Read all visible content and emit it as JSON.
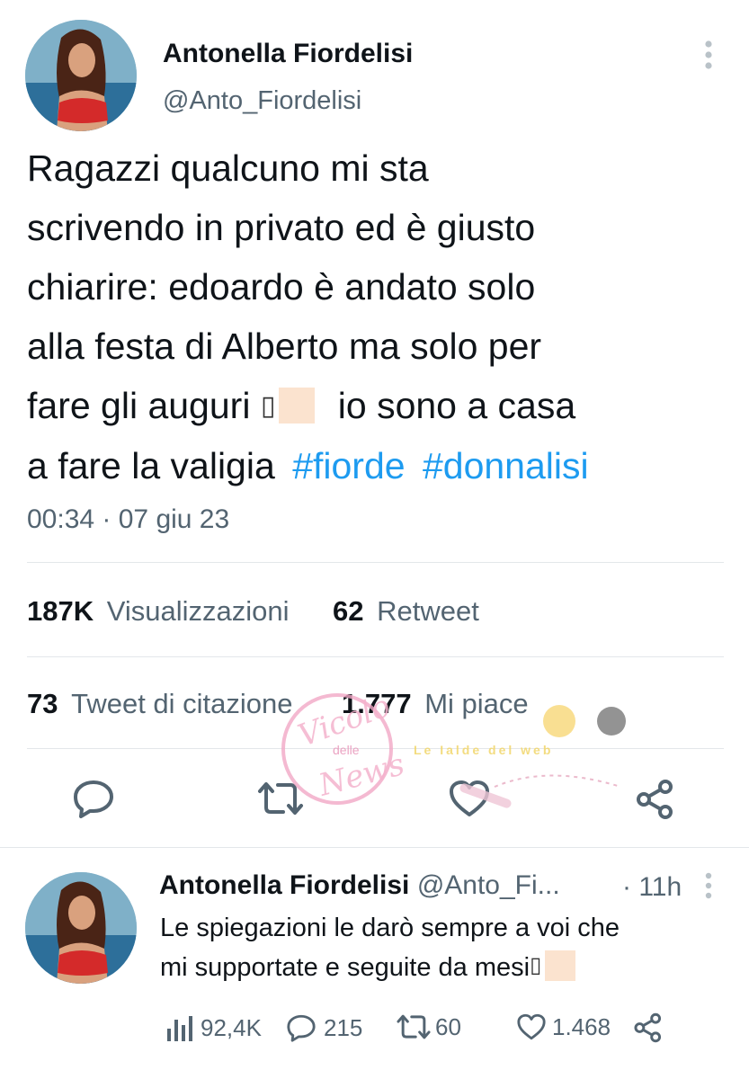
{
  "tweet": {
    "author_name": "Antonella Fiordelisi",
    "author_handle": "@Anto_Fiordelisi",
    "text_lines": [
      "Ragazzi qualcuno mi sta",
      "scrivendo in privato ed è giusto",
      "chiarire: edoardo è andato solo",
      "alla festa di Alberto ma solo per",
      "fare gli auguri",
      "io sono a casa",
      "a fare la valigia"
    ],
    "hashtags": [
      "#fiorde",
      "#donnalisi"
    ],
    "timestamp": "00:34 · 07 giu 23",
    "views_count": "187K",
    "views_label": "Visualizzazioni",
    "retweets_count": "62",
    "retweets_label": "Retweet",
    "quotes_count": "73",
    "quotes_label": "Tweet di citazione",
    "likes_count": "1.777",
    "likes_label": "Mi piace"
  },
  "reply": {
    "author_name": "Antonella Fiordelisi",
    "author_handle": "@Anto_Fi...",
    "time": "· 11h",
    "text_line1": "Le spiegazioni le darò sempre a voi che",
    "text_line2": "mi supportate e seguite da mesi",
    "views": "92,4K",
    "replies": "215",
    "retweets": "60",
    "likes": "1.468"
  },
  "watermarks": {
    "vicolo_line1": "Vicolo",
    "vicolo_line2": "delle",
    "vicolo_line3": "News",
    "leleide": "Le Ialde del web"
  },
  "colors": {
    "accent": "#1d9bf0",
    "secondary_text": "#536471",
    "primary_text": "#0f1419",
    "divider": "#e3e7ea"
  },
  "icons": [
    "more-vertical-icon",
    "reply-icon",
    "retweet-icon",
    "like-icon",
    "share-icon",
    "views-icon"
  ]
}
